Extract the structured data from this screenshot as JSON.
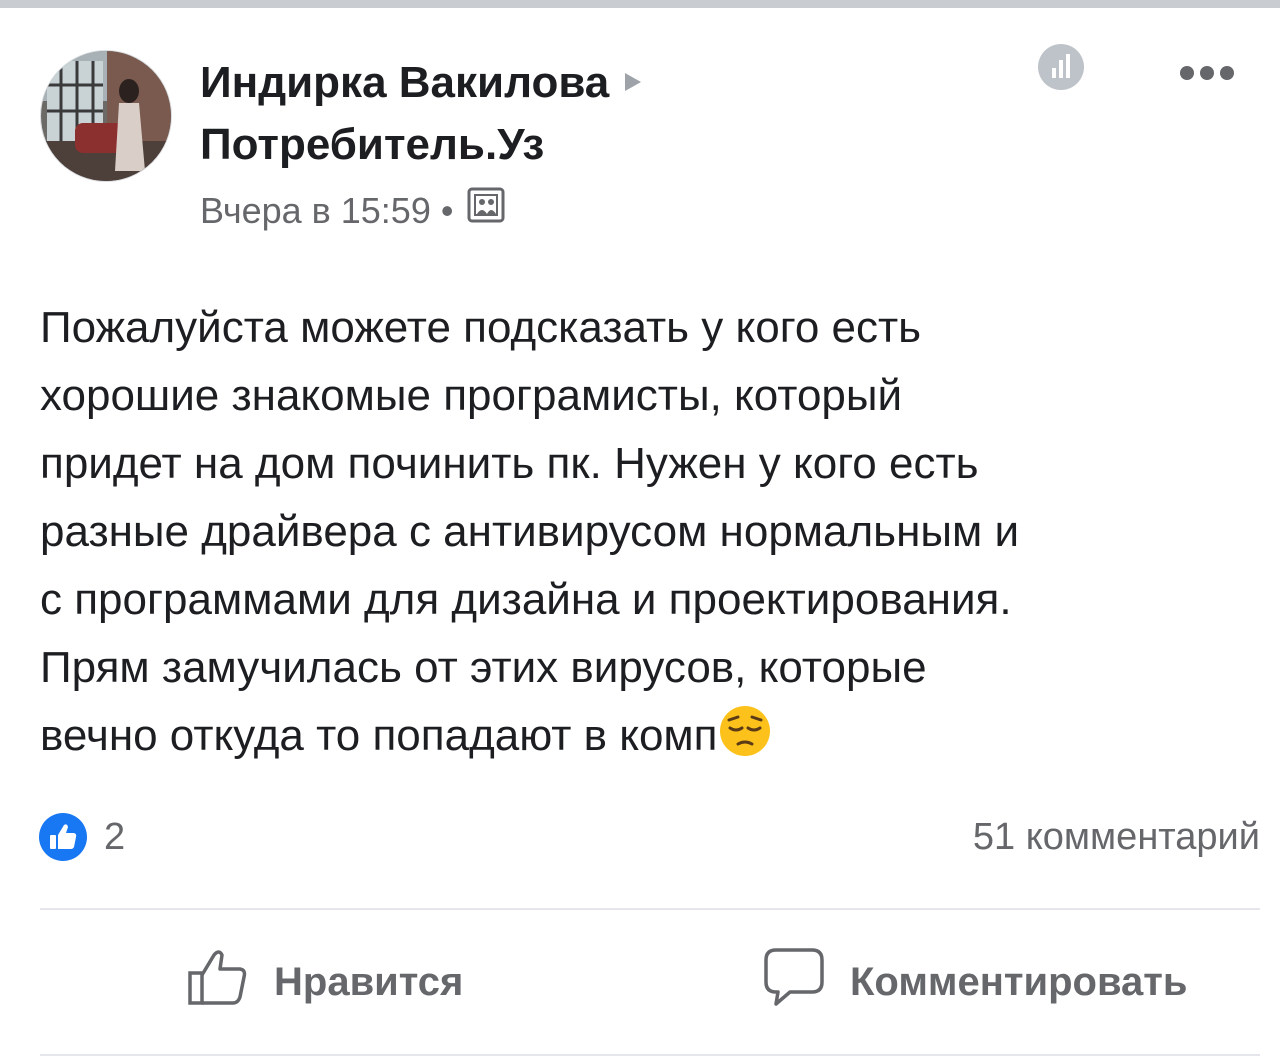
{
  "post": {
    "author_name": "Индирка Вакилова",
    "group_name": "Потребитель.Уз",
    "timestamp": "Вчера в 15:59",
    "separator": "•",
    "audience_icon": "group-audience-icon",
    "insights_icon": "insights-icon",
    "more_icon": "more-options-icon",
    "text_lines": [
      "Пожалуйста можете подсказать  у кого есть",
      "хорошие знакомые програмисты, который",
      "придет на дом починить пк. Нужен у кого есть",
      "разные драйвера с антивирусом нормальным и",
      "с программами для дизайна и проектирования.",
      "Прям замучилась от этих вирусов, которые",
      "вечно откуда то попадают в комп"
    ],
    "trailing_emoji": "pensive-face-emoji"
  },
  "reactions": {
    "like_count": "2",
    "comments_count": "51 комментарий"
  },
  "actions": {
    "like_label": "Нравится",
    "comment_label": "Комментировать"
  },
  "colors": {
    "like_blue": "#1877f2",
    "secondary_text": "#65676b",
    "primary_text": "#1c1e21"
  }
}
